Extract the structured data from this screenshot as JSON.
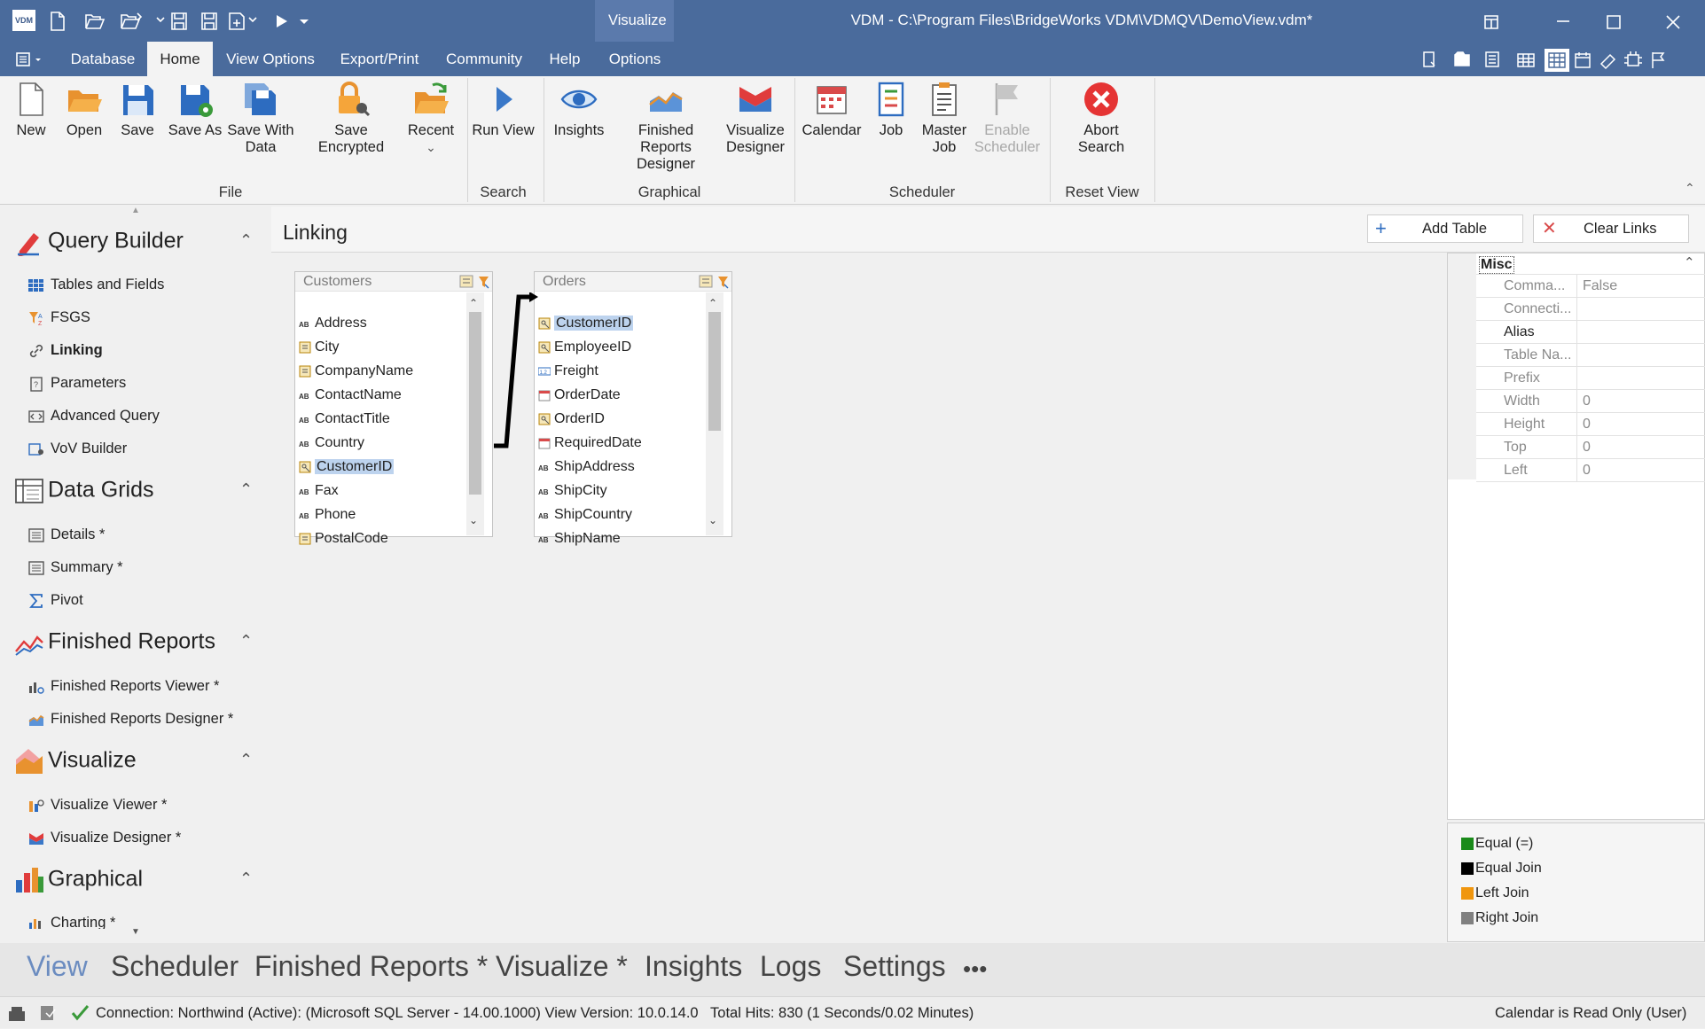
{
  "app": {
    "logo": "VDM",
    "window_title": "VDM - C:\\Program Files\\BridgeWorks VDM\\VDMQV\\DemoView.vdm*",
    "context_tab": "Visualize"
  },
  "menu": {
    "items": [
      "Database",
      "Home",
      "View Options",
      "Export/Print",
      "Community",
      "Help",
      "Options"
    ],
    "active": "Home"
  },
  "ribbon": {
    "groups": {
      "file": "File",
      "search": "Search",
      "graphical": "Graphical",
      "scheduler": "Scheduler",
      "reset": "Reset View"
    },
    "buttons": {
      "new": "New",
      "open": "Open",
      "save": "Save",
      "save_as": "Save As",
      "save_with_data_1": "Save With",
      "save_with_data_2": "Data",
      "save_encrypted": "Save Encrypted",
      "recent": "Recent",
      "run_view": "Run View",
      "insights": "Insights",
      "frd_1": "Finished Reports",
      "frd_2": "Designer",
      "vd_1": "Visualize",
      "vd_2": "Designer",
      "calendar": "Calendar",
      "job": "Job",
      "master_job_1": "Master",
      "master_job_2": "Job",
      "enable_scheduler_1": "Enable",
      "enable_scheduler_2": "Scheduler",
      "abort_1": "Abort",
      "abort_2": "Search"
    }
  },
  "nav": {
    "query_builder": {
      "title": "Query Builder",
      "items": [
        "Tables and Fields",
        "FSGS",
        "Linking",
        "Parameters",
        "Advanced Query",
        "VoV Builder"
      ],
      "active": "Linking"
    },
    "data_grids": {
      "title": "Data Grids",
      "items": [
        "Details *",
        "Summary *",
        "Pivot"
      ]
    },
    "finished_reports": {
      "title": "Finished Reports",
      "items": [
        "Finished Reports Viewer *",
        "Finished Reports Designer *"
      ]
    },
    "visualize": {
      "title": "Visualize",
      "items": [
        "Visualize Viewer *",
        "Visualize Designer *"
      ]
    },
    "graphical": {
      "title": "Graphical",
      "items": [
        "Charting *"
      ]
    }
  },
  "linking": {
    "title": "Linking",
    "add_table": "Add Table",
    "clear_links": "Clear Links",
    "customers": {
      "name": "Customers",
      "fields": [
        "Address",
        "City",
        "CompanyName",
        "ContactName",
        "ContactTitle",
        "Country",
        "CustomerID",
        "Fax",
        "Phone",
        "PostalCode"
      ],
      "selected": "CustomerID"
    },
    "orders": {
      "name": "Orders",
      "fields": [
        "CustomerID",
        "EmployeeID",
        "Freight",
        "OrderDate",
        "OrderID",
        "RequiredDate",
        "ShipAddress",
        "ShipCity",
        "ShipCountry",
        "ShipName"
      ],
      "selected": "CustomerID"
    }
  },
  "properties": {
    "category": "Misc",
    "rows": [
      {
        "key": "Comma...",
        "value": "False"
      },
      {
        "key": "Connecti...",
        "value": ""
      },
      {
        "key": "Alias",
        "value": ""
      },
      {
        "key": "Table Na...",
        "value": ""
      },
      {
        "key": "Prefix",
        "value": ""
      },
      {
        "key": "Width",
        "value": "0"
      },
      {
        "key": "Height",
        "value": "0"
      },
      {
        "key": "Top",
        "value": "0"
      },
      {
        "key": "Left",
        "value": "0"
      }
    ]
  },
  "legend": [
    {
      "label": "Equal (=)",
      "color": "#1a8a1a"
    },
    {
      "label": "Equal Join",
      "color": "#000000"
    },
    {
      "label": "Left Join",
      "color": "#f0960e"
    },
    {
      "label": "Right Join",
      "color": "#808080"
    }
  ],
  "bottom_tabs": [
    "View",
    "Scheduler",
    "Finished Reports *",
    "Visualize *",
    "Insights",
    "Logs",
    "Settings",
    "•••"
  ],
  "status": {
    "connection": "Connection: Northwind (Active): (Microsoft SQL Server - 14.00.1000) View Version: 10.0.14.0   Total Hits: 830 (1 Seconds/0.02 Minutes)",
    "calendar": "Calendar is Read Only (User)"
  }
}
